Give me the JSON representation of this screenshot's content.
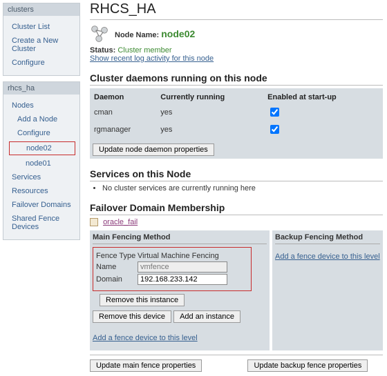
{
  "sidebar": {
    "clusters": {
      "header": "clusters",
      "items": [
        "Cluster List",
        "Create a New Cluster",
        "Configure"
      ]
    },
    "rhcs": {
      "header": "rhcs_ha",
      "nodes_label": "Nodes",
      "add_node": "Add a Node",
      "configure": "Configure",
      "node_selected": "node02",
      "node_other": "node01",
      "rest": [
        "Services",
        "Resources",
        "Failover Domains",
        "Shared Fence Devices"
      ]
    }
  },
  "page": {
    "title": "RHCS_HA",
    "node_name_label": "Node Name:",
    "node_name": "node02",
    "status_label": "Status:",
    "status_value": "Cluster member",
    "log_link": "Show recent log activity for this node"
  },
  "daemons": {
    "heading": "Cluster daemons running on this node",
    "cols": [
      "Daemon",
      "Currently running",
      "Enabled at start-up"
    ],
    "rows": [
      {
        "name": "cman",
        "running": "yes",
        "enabled": true
      },
      {
        "name": "rgmanager",
        "running": "yes",
        "enabled": true
      }
    ],
    "update_btn": "Update node daemon properties"
  },
  "services": {
    "heading": "Services on this Node",
    "empty": "No cluster services are currently running here"
  },
  "failover": {
    "heading": "Failover Domain Membership",
    "domain": "oracle_fail"
  },
  "fence": {
    "main_head": "Main Fencing Method",
    "backup_head": "Backup Fencing Method",
    "type_label": "Fence Type",
    "type_value": "Virtual Machine Fencing",
    "name_label": "Name",
    "name_value": "vmfence",
    "domain_label": "Domain",
    "domain_value": "192.168.233.142",
    "remove_instance": "Remove this instance",
    "remove_device": "Remove this device",
    "add_instance": "Add an instance",
    "add_device_link": "Add a fence device to this level",
    "update_main": "Update main fence properties",
    "update_backup": "Update backup fence properties"
  }
}
